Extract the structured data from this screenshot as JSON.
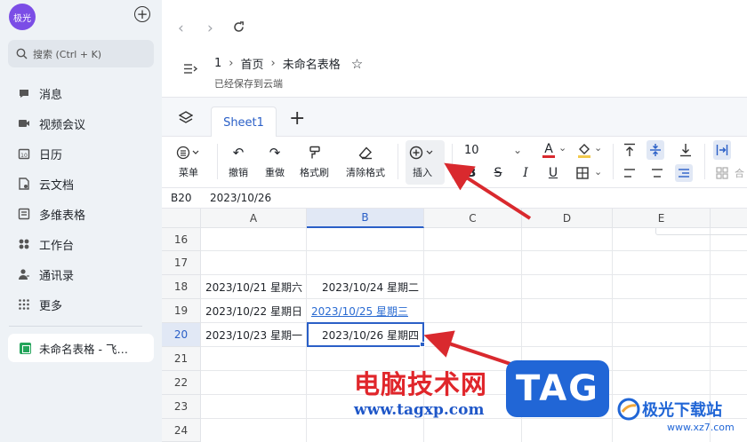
{
  "sidebar": {
    "avatar_text": "极光",
    "search_placeholder": "搜索 (Ctrl + K)",
    "items": [
      {
        "label": "消息",
        "icon": "message-icon"
      },
      {
        "label": "视频会议",
        "icon": "video-icon"
      },
      {
        "label": "日历",
        "icon": "calendar-icon"
      },
      {
        "label": "云文档",
        "icon": "cloud-doc-icon"
      },
      {
        "label": "多维表格",
        "icon": "table-icon"
      },
      {
        "label": "工作台",
        "icon": "workspace-icon"
      },
      {
        "label": "通讯录",
        "icon": "contacts-icon"
      },
      {
        "label": "更多",
        "icon": "more-icon"
      }
    ],
    "open_doc": "未命名表格 - 飞…"
  },
  "header": {
    "breadcrumb": [
      "1",
      "首页",
      "未命名表格"
    ],
    "saved_status": "已经保存到云端"
  },
  "tabs": {
    "sheet_name": "Sheet1"
  },
  "toolbar": {
    "menu": "菜单",
    "undo": "撤销",
    "redo": "重做",
    "format_painter": "格式刷",
    "clear_format": "清除格式",
    "insert": "插入",
    "font_size": "10",
    "bold": "B",
    "strikethrough": "S",
    "italic": "I",
    "underline": "U",
    "font_color_glyph": "A",
    "more_label": "合"
  },
  "formula_bar": {
    "cell_ref": "B20",
    "value": "2023/10/26"
  },
  "grid": {
    "columns": [
      "A",
      "B",
      "C",
      "D",
      "E"
    ],
    "selected_column": "B",
    "rows": [
      "16",
      "17",
      "18",
      "19",
      "20",
      "21",
      "22",
      "23",
      "24"
    ],
    "selected_row": "20",
    "cells": {
      "A18": "2023/10/21 星期六",
      "B18": "2023/10/24 星期二",
      "A19": "2023/10/22 星期日",
      "B19": "2023/10/25 星期三",
      "A20": "2023/10/23 星期一",
      "B20": "2023/10/26 星期四"
    }
  },
  "watermark": {
    "site_name": "电脑技术网",
    "site_url": "www.tagxp.com",
    "tag": "TAG",
    "brand": "极光下载站",
    "brand_url": "www.xz7.com"
  },
  "colors": {
    "accent": "#2a5fc7",
    "annotation_arrow": "#d9292e",
    "sheet_icon": "#23a45a",
    "avatar": "#7b4de6"
  }
}
